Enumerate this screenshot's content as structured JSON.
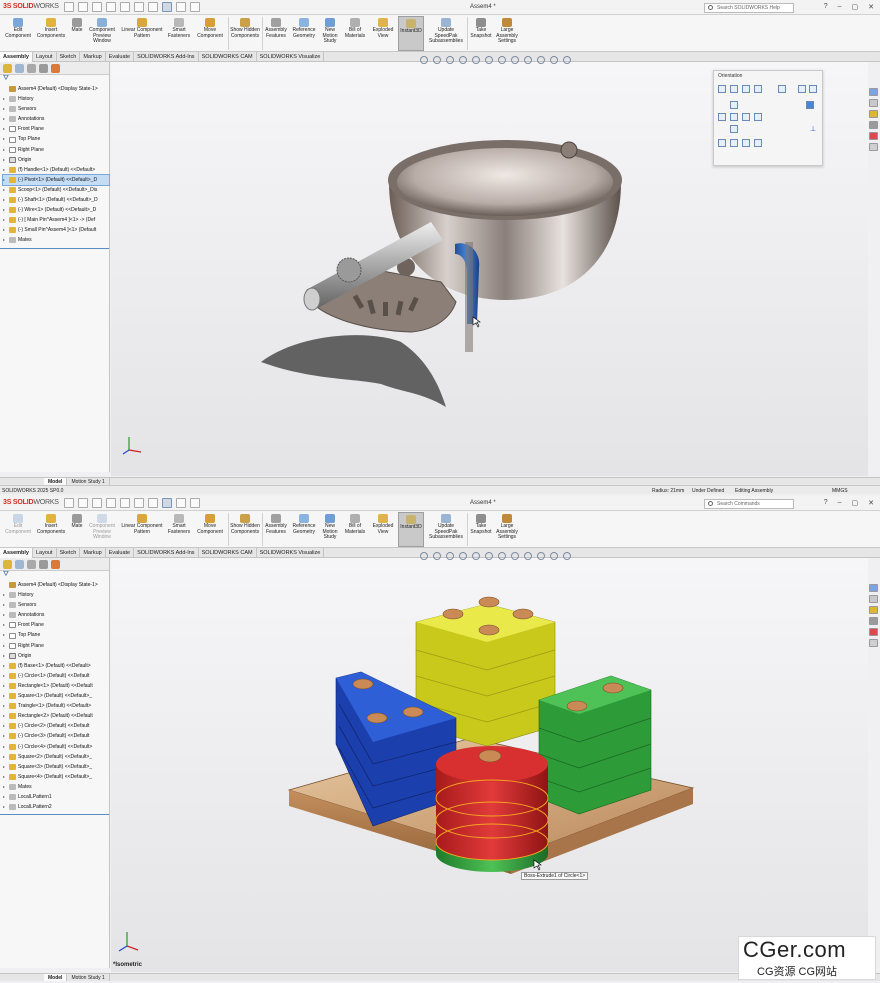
{
  "panes": [
    {
      "window_title": "Assem4 *",
      "search_placeholder": "Search SOLIDWORKS Help",
      "ribbon": [
        {
          "label": "Edit Component",
          "dim": false
        },
        {
          "label": "Insert Components",
          "dim": false
        },
        {
          "label": "Mate",
          "dim": false
        },
        {
          "label": "Component Preview Window",
          "dim": false
        },
        {
          "label": "Linear Component Pattern",
          "dim": false
        },
        {
          "label": "Smart Fasteners",
          "dim": false
        },
        {
          "label": "Move Component",
          "dim": false
        },
        {
          "label": "Show Hidden Components",
          "dim": false
        },
        {
          "label": "Assembly Features",
          "dim": false
        },
        {
          "label": "Reference Geometry",
          "dim": false
        },
        {
          "label": "New Motion Study",
          "dim": false
        },
        {
          "label": "Bill of Materials",
          "dim": false
        },
        {
          "label": "Exploded View",
          "dim": false
        },
        {
          "label": "Instant3D",
          "dim": false
        },
        {
          "label": "Update SpeedPak Subassemblies",
          "dim": false
        },
        {
          "label": "Take Snapshot",
          "dim": false
        },
        {
          "label": "Large Assembly Settings",
          "dim": false
        }
      ],
      "tabs": [
        "Assembly",
        "Layout",
        "Sketch",
        "Markup",
        "Evaluate",
        "SOLIDWORKS Add-Ins",
        "SOLIDWORKS CAM",
        "SOLIDWORKS Visualize"
      ],
      "tree": [
        {
          "label": "Assem4 (Default) <Display State-1>",
          "icon": "assembly",
          "highlight": false
        },
        {
          "label": "History",
          "icon": "history",
          "highlight": false
        },
        {
          "label": "Sensors",
          "icon": "history",
          "highlight": false
        },
        {
          "label": "Annotations",
          "icon": "annotation",
          "highlight": false
        },
        {
          "label": "Front Plane",
          "icon": "plane",
          "highlight": false
        },
        {
          "label": "Top Plane",
          "icon": "plane",
          "highlight": false
        },
        {
          "label": "Right Plane",
          "icon": "plane",
          "highlight": false
        },
        {
          "label": "Origin",
          "icon": "origin",
          "highlight": false
        },
        {
          "label": "(f) Handle<1> (Default) <<Default>",
          "icon": "part",
          "highlight": false
        },
        {
          "label": "(-) Pivot<1> (Default) <<Default>_D",
          "icon": "part",
          "highlight": true
        },
        {
          "label": "Scoop<1> (Default) <<Default>_Dis",
          "icon": "part",
          "highlight": false
        },
        {
          "label": "(-) Shaft<1> (Default) <<Default>_D",
          "icon": "part",
          "highlight": false
        },
        {
          "label": "(-) Wire<1> (Default) <<Default>_D",
          "icon": "part",
          "highlight": false
        },
        {
          "label": "(-) [ Main Pin^Assem4 ]<1> -> (Def",
          "icon": "part",
          "highlight": false
        },
        {
          "label": "(-) Small Pin^Assem4 ]<1> (Default",
          "icon": "part",
          "highlight": false
        },
        {
          "label": "Mates",
          "icon": "mates",
          "highlight": false
        }
      ],
      "bottom_tabs": [
        "Model",
        "Motion Study 1"
      ],
      "status": {
        "left": "SOLIDWORKS 2025 SP0.0",
        "radius": "Radius: 21mm",
        "defined": "Under Defined",
        "mode": "Editing Assembly",
        "units": "MMGS"
      },
      "orientation_title": "Orientation"
    },
    {
      "window_title": "Assem4 *",
      "search_placeholder": "Search Commands",
      "ribbon": [
        {
          "label": "Edit Component",
          "dim": true
        },
        {
          "label": "Insert Components",
          "dim": false
        },
        {
          "label": "Mate",
          "dim": false
        },
        {
          "label": "Component Preview Window",
          "dim": true
        },
        {
          "label": "Linear Component Pattern",
          "dim": false
        },
        {
          "label": "Smart Fasteners",
          "dim": false
        },
        {
          "label": "Move Component",
          "dim": false
        },
        {
          "label": "Show Hidden Components",
          "dim": false
        },
        {
          "label": "Assembly Features",
          "dim": false
        },
        {
          "label": "Reference Geometry",
          "dim": false
        },
        {
          "label": "New Motion Study",
          "dim": false
        },
        {
          "label": "Bill of Materials",
          "dim": false
        },
        {
          "label": "Exploded View",
          "dim": false
        },
        {
          "label": "Instant3D",
          "dim": false
        },
        {
          "label": "Update SpeedPak Subassemblies",
          "dim": false
        },
        {
          "label": "Take Snapshot",
          "dim": false
        },
        {
          "label": "Large Assembly Settings",
          "dim": false
        }
      ],
      "tabs": [
        "Assembly",
        "Layout",
        "Sketch",
        "Markup",
        "Evaluate",
        "SOLIDWORKS Add-Ins",
        "SOLIDWORKS CAM",
        "SOLIDWORKS Visualize"
      ],
      "tree": [
        {
          "label": "Assem4 (Default) <Display State-1>",
          "icon": "assembly",
          "highlight": false
        },
        {
          "label": "History",
          "icon": "history",
          "highlight": false
        },
        {
          "label": "Sensors",
          "icon": "history",
          "highlight": false
        },
        {
          "label": "Annotations",
          "icon": "annotation",
          "highlight": false
        },
        {
          "label": "Front Plane",
          "icon": "plane",
          "highlight": false
        },
        {
          "label": "Top Plane",
          "icon": "plane",
          "highlight": false
        },
        {
          "label": "Right Plane",
          "icon": "plane",
          "highlight": false
        },
        {
          "label": "Origin",
          "icon": "origin",
          "highlight": false
        },
        {
          "label": "(f) Base<1> (Default) <<Default>",
          "icon": "part",
          "highlight": false
        },
        {
          "label": "(-) Circle<1> (Default) <<Default",
          "icon": "part",
          "highlight": false
        },
        {
          "label": "Rectangle<1> (Default) <<Default",
          "icon": "part",
          "highlight": false
        },
        {
          "label": "Square<1> (Default) <<Default>_",
          "icon": "part",
          "highlight": false
        },
        {
          "label": "Traingle<1> (Default) <<Default>",
          "icon": "part",
          "highlight": false
        },
        {
          "label": "Rectangle<2> (Default) <<Default",
          "icon": "part",
          "highlight": false
        },
        {
          "label": "(-) Circle<2> (Default) <<Default",
          "icon": "part",
          "highlight": false
        },
        {
          "label": "(-) Circle<3> (Default) <<Default",
          "icon": "part",
          "highlight": false
        },
        {
          "label": "(-) Circle<4> (Default) <<Default>",
          "icon": "part",
          "highlight": false
        },
        {
          "label": "Square<2> (Default) <<Default>_",
          "icon": "part",
          "highlight": false
        },
        {
          "label": "Square<3> (Default) <<Default>_",
          "icon": "part",
          "highlight": false
        },
        {
          "label": "Square<4> (Default) <<Default>_",
          "icon": "part",
          "highlight": false
        },
        {
          "label": "Mates",
          "icon": "mates",
          "highlight": false
        },
        {
          "label": "LocalLPattern1",
          "icon": "pattern",
          "highlight": false
        },
        {
          "label": "LocalLPattern2",
          "icon": "pattern",
          "highlight": false
        }
      ],
      "bottom_tabs": [
        "Model",
        "Motion Study 1"
      ],
      "view_label": "*Isometric",
      "tooltip": "Boss-Extrude1 of Circle<1>"
    }
  ],
  "watermark": {
    "big": "CGer.com",
    "small": "CG资源 CG网站"
  },
  "colors": {
    "brand": "#d52b1e",
    "selection": "#c5dcf5",
    "active_ribbon": "#c9c9c9"
  }
}
